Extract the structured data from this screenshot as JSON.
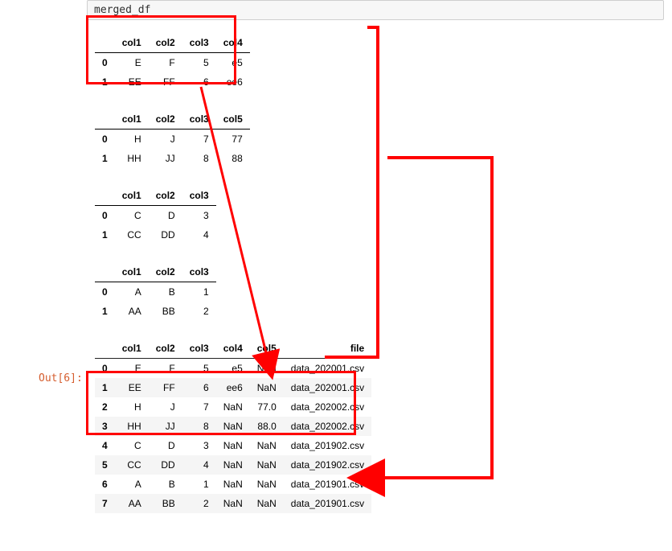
{
  "code_line": "merged_df",
  "out_label": "Out[6]:",
  "headers": {
    "idx": "",
    "col1": "col1",
    "col2": "col2",
    "col3": "col3",
    "col4": "col4",
    "col5": "col5",
    "file": "file"
  },
  "small_tables": [
    {
      "cols": [
        "col1",
        "col2",
        "col3",
        "col4"
      ],
      "rows": [
        {
          "i": "0",
          "c": [
            "E",
            "F",
            "5",
            "e5"
          ]
        },
        {
          "i": "1",
          "c": [
            "EE",
            "FF",
            "6",
            "ee6"
          ]
        }
      ]
    },
    {
      "cols": [
        "col1",
        "col2",
        "col3",
        "col5"
      ],
      "rows": [
        {
          "i": "0",
          "c": [
            "H",
            "J",
            "7",
            "77"
          ]
        },
        {
          "i": "1",
          "c": [
            "HH",
            "JJ",
            "8",
            "88"
          ]
        }
      ]
    },
    {
      "cols": [
        "col1",
        "col2",
        "col3"
      ],
      "rows": [
        {
          "i": "0",
          "c": [
            "C",
            "D",
            "3"
          ]
        },
        {
          "i": "1",
          "c": [
            "CC",
            "DD",
            "4"
          ]
        }
      ]
    },
    {
      "cols": [
        "col1",
        "col2",
        "col3"
      ],
      "rows": [
        {
          "i": "0",
          "c": [
            "A",
            "B",
            "1"
          ]
        },
        {
          "i": "1",
          "c": [
            "AA",
            "BB",
            "2"
          ]
        }
      ]
    }
  ],
  "result": {
    "cols": [
      "col1",
      "col2",
      "col3",
      "col4",
      "col5",
      "file"
    ],
    "rows": [
      {
        "i": "0",
        "c": [
          "E",
          "F",
          "5",
          "e5",
          "NaN",
          "data_202001.csv"
        ]
      },
      {
        "i": "1",
        "c": [
          "EE",
          "FF",
          "6",
          "ee6",
          "NaN",
          "data_202001.csv"
        ]
      },
      {
        "i": "2",
        "c": [
          "H",
          "J",
          "7",
          "NaN",
          "77.0",
          "data_202002.csv"
        ]
      },
      {
        "i": "3",
        "c": [
          "HH",
          "JJ",
          "8",
          "NaN",
          "88.0",
          "data_202002.csv"
        ]
      },
      {
        "i": "4",
        "c": [
          "C",
          "D",
          "3",
          "NaN",
          "NaN",
          "data_201902.csv"
        ]
      },
      {
        "i": "5",
        "c": [
          "CC",
          "DD",
          "4",
          "NaN",
          "NaN",
          "data_201902.csv"
        ]
      },
      {
        "i": "6",
        "c": [
          "A",
          "B",
          "1",
          "NaN",
          "NaN",
          "data_201901.csv"
        ]
      },
      {
        "i": "7",
        "c": [
          "AA",
          "BB",
          "2",
          "NaN",
          "NaN",
          "data_201901.csv"
        ]
      }
    ]
  }
}
